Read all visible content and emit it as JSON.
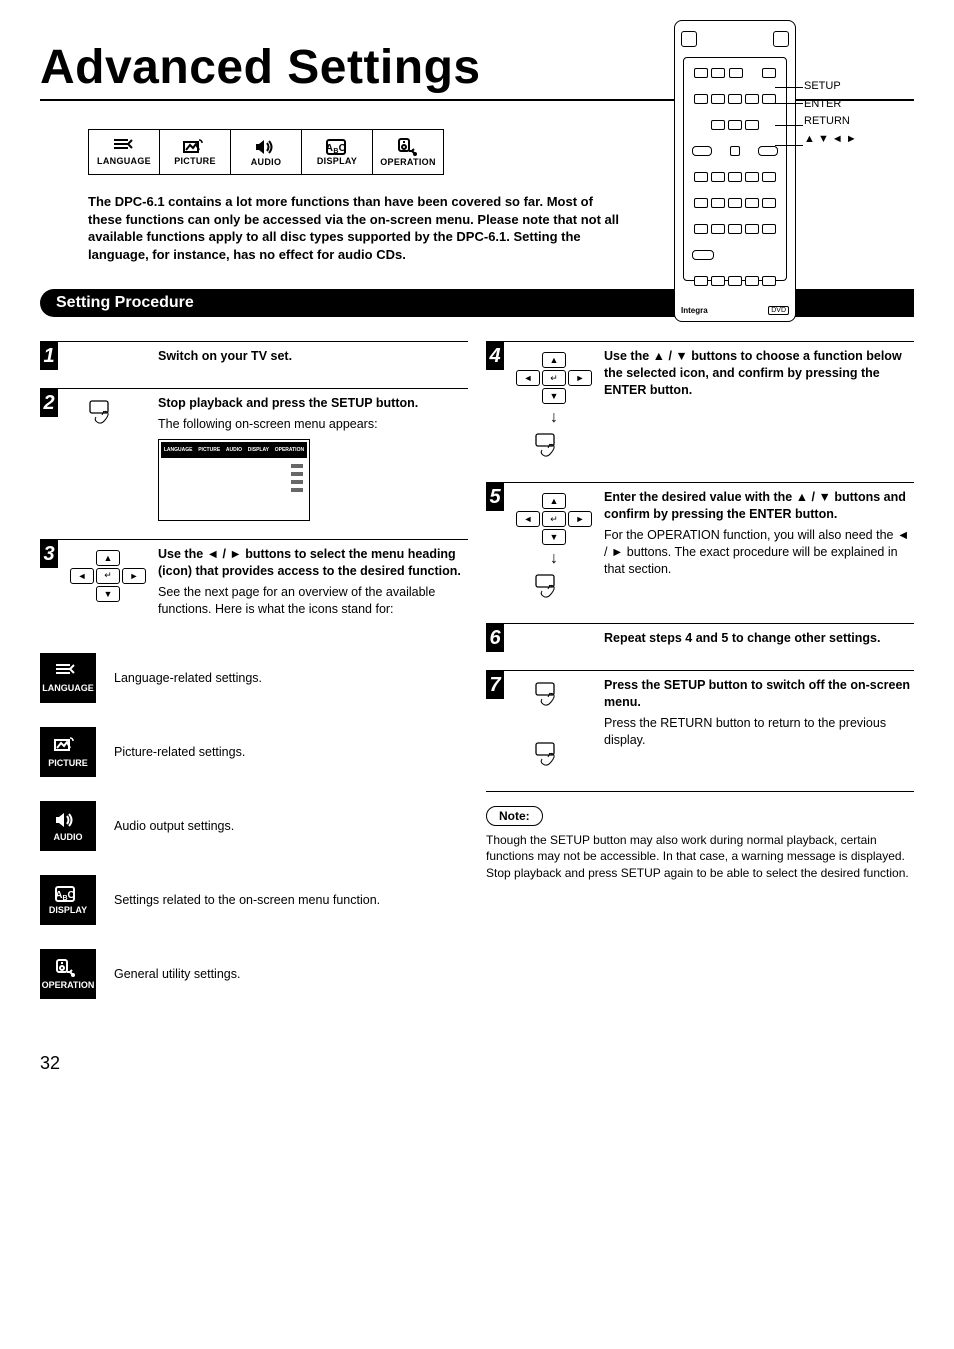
{
  "title": "Advanced Settings",
  "page_number": "32",
  "remote_labels": {
    "setup": "SETUP",
    "enter": "ENTER",
    "return": "RETURN",
    "arrows": "▲ ▼ ◄ ►"
  },
  "remote_brand": "Integra",
  "remote_dvd": "DVD",
  "icon_strip": {
    "language": "LANGUAGE",
    "picture": "PICTURE",
    "audio": "AUDIO",
    "display": "DISPLAY",
    "operation": "OPERATION"
  },
  "intro": "The DPC-6.1 contains a lot more functions than have been covered so far. Most of these functions can only be accessed via the on-screen menu. Please note that not all available functions apply to all disc types supported by the DPC-6.1. Setting the language, for instance, has no effect for audio CDs.",
  "section_title": "Setting Procedure",
  "steps": {
    "s1": {
      "num": "1",
      "title": "Switch on your TV set."
    },
    "s2": {
      "num": "2",
      "title": "Stop playback and press the SETUP button.",
      "body": "The following on-screen menu appears:"
    },
    "s3": {
      "num": "3",
      "title": "Use the ◄ / ► buttons to select the menu heading (icon) that provides access to the desired function.",
      "body": "See the next page for an overview of the available functions. Here is what the icons stand for:"
    },
    "s4": {
      "num": "4",
      "title": "Use the ▲ / ▼ buttons to choose a function below the selected icon, and confirm by pressing the ENTER button."
    },
    "s5": {
      "num": "5",
      "title": "Enter the desired value with the ▲ / ▼ buttons and confirm by pressing the ENTER button.",
      "body": "For the OPERATION function, you will also need the ◄ / ► buttons. The exact procedure will be explained in that section."
    },
    "s6": {
      "num": "6",
      "title": "Repeat steps 4 and 5 to change other settings."
    },
    "s7": {
      "num": "7",
      "title": "Press the SETUP button to switch off the on-screen menu.",
      "body": "Press the RETURN button to return to the previous display."
    }
  },
  "icon_defs": {
    "language": {
      "label": "LANGUAGE",
      "text": "Language-related settings."
    },
    "picture": {
      "label": "PICTURE",
      "text": "Picture-related settings."
    },
    "audio": {
      "label": "AUDIO",
      "text": "Audio output settings."
    },
    "display": {
      "label": "DISPLAY",
      "text": "Settings related to the on-screen menu function."
    },
    "operation": {
      "label": "OPERATION",
      "text": "General utility settings."
    }
  },
  "osd_tabs": {
    "language": "LANGUAGE",
    "picture": "PICTURE",
    "audio": "AUDIO",
    "display": "DISPLAY",
    "operation": "OPERATION"
  },
  "note": {
    "title": "Note:",
    "text": "Though the SETUP button may also work during normal playback, certain functions may not be accessible. In that case, a warning message is displayed. Stop playback and press SETUP again to be able to select the desired function."
  }
}
